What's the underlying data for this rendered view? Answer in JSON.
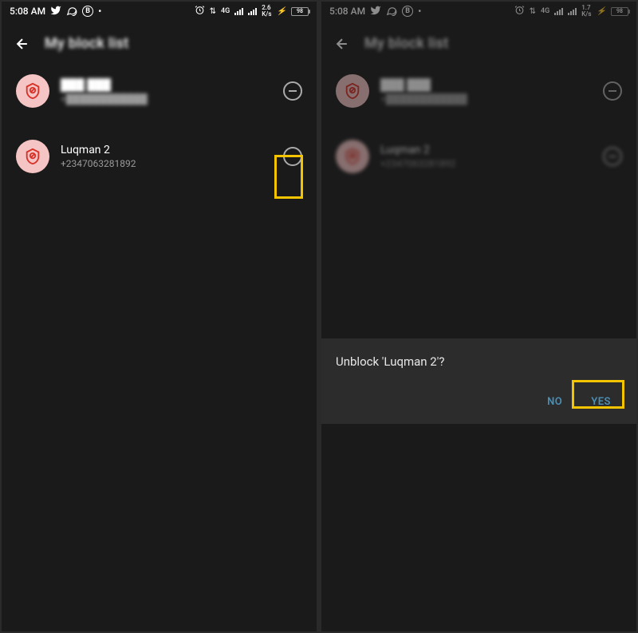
{
  "status": {
    "time": "5:08 AM",
    "network_label": "4G",
    "rate_left": "2.6\nK/s",
    "rate_right": "1.7\nK/s",
    "battery": "98"
  },
  "header": {
    "title": "My block list"
  },
  "contacts": [
    {
      "name": "███ ███",
      "number": "+████████████"
    },
    {
      "name": "Luqman 2",
      "number": "+2347063281892"
    }
  ],
  "dialog": {
    "message": "Unblock 'Luqman 2'?",
    "no": "NO",
    "yes": "YES"
  }
}
